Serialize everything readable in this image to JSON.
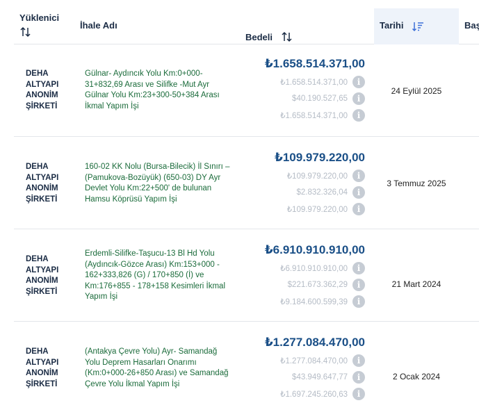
{
  "columns": {
    "company": "Yüklenici",
    "tender": "İhale Adı",
    "amount": "Bedeli",
    "date": "Tarihi",
    "start": "Baş"
  },
  "rows": [
    {
      "company": [
        "DEHA",
        "ALTYAPI",
        "ANONİM",
        "ŞİRKETİ"
      ],
      "tender": "Gülnar- Aydıncık Yolu Km:0+000-31+832,69 Arası ve Silifke -Mut Ayr Gülnar Yolu Km:23+300-50+384 Arası İkmal Yapım İşi",
      "amount": "₺1.658.514.371,00",
      "sub": [
        "₺1.658.514.371,00",
        "$40.190.527,65",
        "₺1.658.514.371,00"
      ],
      "date": "24 Eylül 2025"
    },
    {
      "company": [
        "DEHA",
        "ALTYAPI",
        "ANONİM",
        "ŞİRKETİ"
      ],
      "tender": "160-02 KK Nolu (Bursa-Bilecik) İl Sınırı – (Pamukova-Bozüyük) (650-03) DY Ayr Devlet Yolu Km:22+500' de bulunan Hamsu Köprüsü Yapım İşi",
      "amount": "₺109.979.220,00",
      "sub": [
        "₺109.979.220,00",
        "$2.832.326,04",
        "₺109.979.220,00"
      ],
      "date": "3 Temmuz 2025"
    },
    {
      "company": [
        "DEHA",
        "ALTYAPI",
        "ANONİM",
        "ŞİRKETİ"
      ],
      "tender": "Erdemli-Silifke-Taşucu-13 Bl Hd Yolu (Aydıncık-Gözce Arası) Km:153+000 - 162+333,826 (G) / 170+850 (İ) ve Km:176+855 - 178+158 Kesimleri İkmal Yapım İşi",
      "amount": "₺6.910.910.910,00",
      "sub": [
        "₺6.910.910.910,00",
        "$221.673.362,29",
        "₺9.184.600.599,39"
      ],
      "date": "21 Mart 2024"
    },
    {
      "company": [
        "DEHA",
        "ALTYAPI",
        "ANONİM",
        "ŞİRKETİ"
      ],
      "tender": "(Antakya Çevre Yolu) Ayr- Samandağ Yolu Deprem Hasarları Onarımı (Km:0+000-26+850 Arası) ve Samandağ Çevre Yolu İkmal Yapım İşi",
      "amount": "₺1.277.084.470,00",
      "sub": [
        "₺1.277.084.470,00",
        "$43.949.647,77",
        "₺1.697.245.260,63"
      ],
      "date": "2 Ocak 2024"
    }
  ]
}
